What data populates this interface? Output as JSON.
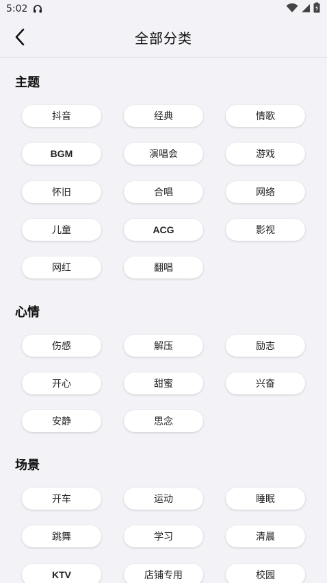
{
  "status_bar": {
    "time": "5:02"
  },
  "header": {
    "title": "全部分类"
  },
  "sections": [
    {
      "title": "主题",
      "items": [
        "抖音",
        "经典",
        "情歌",
        "BGM",
        "演唱会",
        "游戏",
        "怀旧",
        "合唱",
        "网络",
        "儿童",
        "ACG",
        "影视",
        "网红",
        "翻唱"
      ]
    },
    {
      "title": "心情",
      "items": [
        "伤感",
        "解压",
        "励志",
        "开心",
        "甜蜜",
        "兴奋",
        "安静",
        "思念"
      ]
    },
    {
      "title": "场景",
      "items": [
        "开车",
        "运动",
        "睡眠",
        "跳舞",
        "学习",
        "清晨",
        "KTV",
        "店铺专用",
        "校园"
      ]
    }
  ]
}
